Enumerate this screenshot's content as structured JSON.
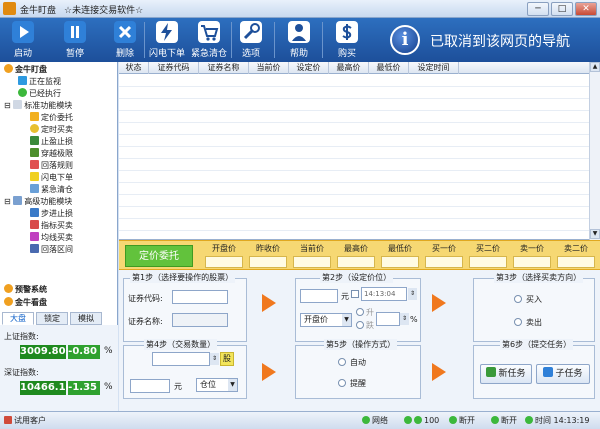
{
  "window": {
    "app_title": "金牛盯盘",
    "subtitle": "☆未连接交易软件☆",
    "minimize": "─",
    "maximize": "□",
    "close": "✕"
  },
  "toolbar": {
    "start": "启动",
    "pause": "暂停",
    "delete": "删除",
    "flash_order": "闪电下单",
    "emergency_clear": "紧急清仓",
    "options": "选项",
    "help": "帮助",
    "purchase": "购买"
  },
  "info_banner": {
    "icon_glyph": "i",
    "text": "已取消到该网页的导航"
  },
  "tree": {
    "group_watch": "金牛盯盘",
    "monitoring": "正在监视",
    "executed": "已经执行",
    "group_standard": "标准功能模块",
    "standard_items": [
      "定价委托",
      "定时买卖",
      "止盈止损",
      "穿越极限",
      "回落规则",
      "闪电下单",
      "紧急清仓"
    ],
    "group_advanced": "高级功能模块",
    "advanced_items": [
      "步进止损",
      "指标买卖",
      "均线买卖",
      "回落区间"
    ],
    "alert_system": "预警系统",
    "group_market": "金牛看盘"
  },
  "market_tabs": [
    "大盘",
    "锁定",
    "模拟"
  ],
  "market": {
    "sh_label": "上证指数:",
    "sh_value": "3009.80",
    "sh_change": "-0.80",
    "sh_unit": "%",
    "sz_label": "深证指数:",
    "sz_value": "10466.16",
    "sz_change": "-1.35",
    "sz_unit": "%"
  },
  "grid": {
    "headers": [
      "状态",
      "证券代码",
      "证券名称",
      "当前价",
      "设定价",
      "最高价",
      "最低价",
      "设定时间"
    ]
  },
  "quote": {
    "title": "定价委托",
    "labels": [
      "开盘价",
      "昨收价",
      "当前价",
      "最高价",
      "最低价",
      "买一价",
      "买二价",
      "卖一价",
      "卖二价"
    ]
  },
  "step1": {
    "title": "第1步（选择要操作的股票）",
    "code_label": "证券代码:",
    "name_label": "证券名称:"
  },
  "step2": {
    "title": "第2步（设定价位）",
    "yuan": "元",
    "time_value": "14:13:04",
    "mode_value": "开盘价",
    "rise": "升",
    "fall": "跌",
    "percent": "%"
  },
  "step3": {
    "title": "第3步（选择买卖方向）",
    "buy": "买入",
    "sell": "卖出"
  },
  "step4": {
    "title": "第4步（交易数量）",
    "unit": "股",
    "yuan": "元",
    "position": "仓位"
  },
  "step5": {
    "title": "第5步（操作方式）",
    "auto": "自动",
    "remind": "提醒"
  },
  "step6": {
    "title": "第6步（提交任务）",
    "new_task": "新任务",
    "sub_task": "子任务"
  },
  "statusbar": {
    "user": "试用客户",
    "network": "网络",
    "progress": "100",
    "disconnect1": "断开",
    "disconnect2": "断开",
    "time_label": "时间",
    "time": "14:13:19"
  },
  "colors": {
    "toolbar": "#1d4f9a",
    "quote_strip": "#f6d873",
    "accent_orange": "#f0781e",
    "index_green": "#1f8a1f"
  }
}
